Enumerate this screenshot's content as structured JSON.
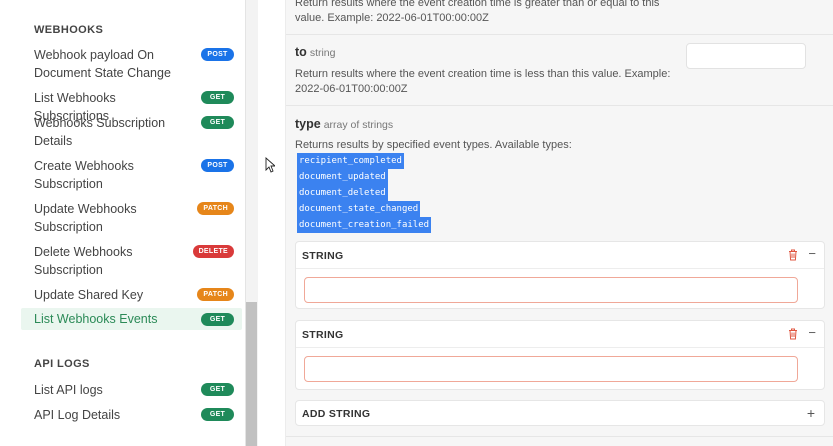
{
  "sidebar": {
    "sections": [
      {
        "title": "WEBHOOKS"
      },
      {
        "title": "API LOGS"
      }
    ],
    "webhook_items": [
      {
        "label": "Webhook payload On Document State Change",
        "method": "POST"
      },
      {
        "label": "List Webhooks Subscriptions",
        "method": "GET"
      },
      {
        "label": "Webhooks Subscription Details",
        "method": "GET"
      },
      {
        "label": "Create Webhooks Subscription",
        "method": "POST"
      },
      {
        "label": "Update Webhooks Subscription",
        "method": "PATCH"
      },
      {
        "label": "Delete Webhooks Subscription",
        "method": "DELETE"
      },
      {
        "label": "Update Shared Key",
        "method": "PATCH"
      },
      {
        "label": "List Webhooks Events",
        "method": "GET"
      }
    ],
    "api_log_items": [
      {
        "label": "List API logs",
        "method": "GET"
      },
      {
        "label": "API Log Details",
        "method": "GET"
      }
    ]
  },
  "params": {
    "from_desc_line1": "Return results where the event creation time is greater than or equal to this",
    "from_desc_line2": "value. Example: 2022-06-01T00:00:00Z",
    "to": {
      "name": "to",
      "type": "string",
      "desc_line1": "Return results where the event creation time is less than this value. Example:",
      "desc_line2": "2022-06-01T00:00:00Z"
    },
    "type": {
      "name": "type",
      "type": "array of strings",
      "desc": "Returns results by specified event types. Available types:",
      "values": [
        "recipient_completed",
        "document_updated",
        "document_deleted",
        "document_state_changed",
        "document_creation_failed"
      ]
    },
    "string_cards": [
      {
        "title": "STRING",
        "value": ""
      },
      {
        "title": "STRING",
        "value": ""
      }
    ],
    "add_label": "ADD STRING"
  }
}
